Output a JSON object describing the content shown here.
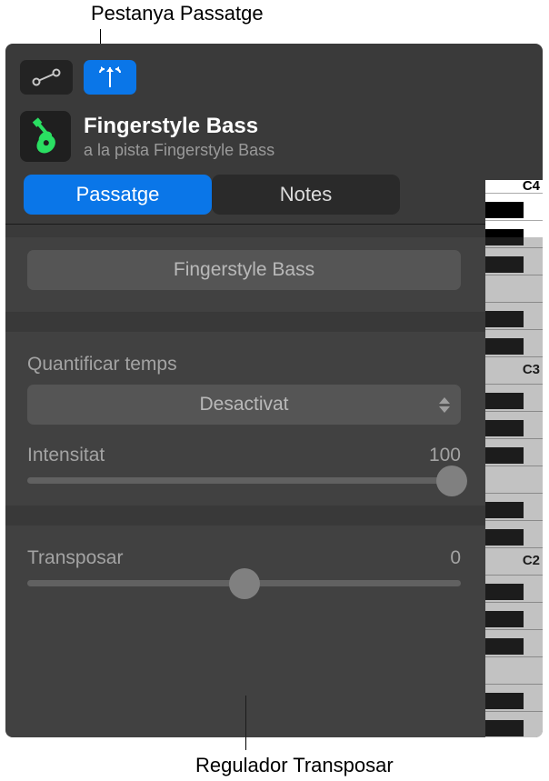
{
  "callouts": {
    "top": "Pestanya Passatge",
    "bottom": "Regulador Transposar"
  },
  "toolbar": {
    "automation_icon": "automation-icon",
    "flex_icon": "catch-playhead-icon"
  },
  "track": {
    "title": "Fingerstyle Bass",
    "subtitle": "a la pista Fingerstyle Bass",
    "icon": "bass-guitar-icon",
    "iconColor": "#2adf62"
  },
  "tabs": {
    "region": "Passatge",
    "notes": "Notes"
  },
  "region": {
    "name": "Fingerstyle Bass"
  },
  "quantize": {
    "label": "Quantificar temps",
    "value": "Desactivat"
  },
  "strength": {
    "label": "Intensitat",
    "value": "100",
    "sliderPct": 98
  },
  "transpose": {
    "label": "Transposar",
    "value": "0",
    "sliderPct": 50
  },
  "piano": {
    "labels": [
      "C4",
      "C3",
      "C2"
    ]
  }
}
